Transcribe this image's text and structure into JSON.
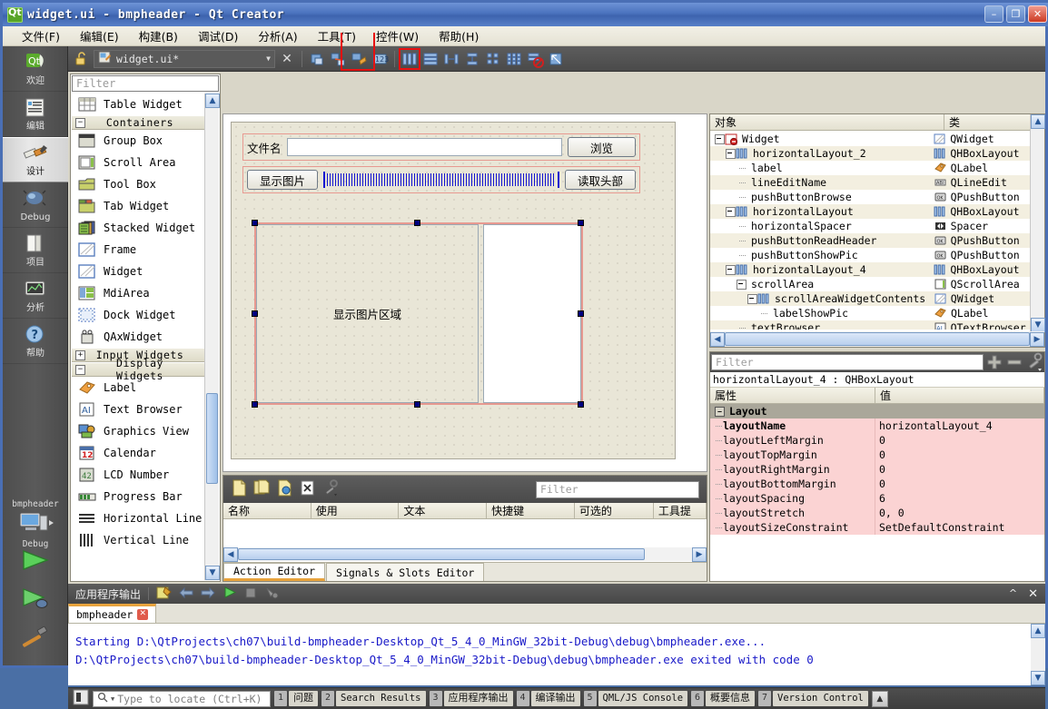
{
  "window": {
    "title": "widget.ui - bmpheader - Qt Creator",
    "logo_icon": "qt-logo-icon",
    "minimize_label": "–",
    "maximize_label": "❐",
    "close_label": "✕"
  },
  "menubar": {
    "items": [
      {
        "label": "文件(F)",
        "name": "menu-file"
      },
      {
        "label": "编辑(E)",
        "name": "menu-edit"
      },
      {
        "label": "构建(B)",
        "name": "menu-build"
      },
      {
        "label": "调试(D)",
        "name": "menu-debug"
      },
      {
        "label": "分析(A)",
        "name": "menu-analyze"
      },
      {
        "label": "工具(T)",
        "name": "menu-tools"
      },
      {
        "label": "控件(W)",
        "name": "menu-window"
      },
      {
        "label": "帮助(H)",
        "name": "menu-help"
      }
    ]
  },
  "modebar": {
    "items": [
      {
        "label": "欢迎",
        "icon": "qt-welcome-icon",
        "active": false
      },
      {
        "label": "编辑",
        "icon": "edit-document-icon",
        "active": false
      },
      {
        "label": "设计",
        "icon": "design-brush-icon",
        "active": true
      },
      {
        "label": "Debug",
        "icon": "debug-bug-icon",
        "active": false
      },
      {
        "label": "项目",
        "icon": "projects-folder-icon",
        "active": false
      },
      {
        "label": "分析",
        "icon": "analyze-chart-icon",
        "active": false
      },
      {
        "label": "帮助",
        "icon": "help-question-icon",
        "active": false
      }
    ],
    "kit": {
      "project": "bmpheader",
      "config": "Debug",
      "icon": "target-computer-icon"
    },
    "run_buttons": [
      {
        "name": "run-button",
        "icon": "run-play-icon"
      },
      {
        "name": "debug-button",
        "icon": "debug-play-icon"
      },
      {
        "name": "build-button",
        "icon": "build-hammer-icon"
      }
    ]
  },
  "editor_toolbar": {
    "lock_icon": "unlock-icon",
    "file_icon": "ui-file-icon",
    "filename": "widget.ui*",
    "dropdown_icon": "chevron-down-icon",
    "close_icon": "close-icon",
    "buttons": [
      {
        "name": "edit-widgets-button",
        "icon": "edit-widgets-icon",
        "highlighted": false
      },
      {
        "name": "edit-signals-slots-button",
        "icon": "edit-signals-slots-icon",
        "highlighted": false
      },
      {
        "name": "edit-buddies-button",
        "icon": "edit-buddies-icon",
        "highlighted": false
      },
      {
        "name": "edit-tab-order-button",
        "icon": "edit-tab-order-icon",
        "highlighted": false
      },
      {
        "name": "layout-horizontally-button",
        "icon": "layout-horizontal-icon",
        "highlighted": true
      },
      {
        "name": "layout-vertically-button",
        "icon": "layout-vertical-icon",
        "highlighted": false
      },
      {
        "name": "layout-splitter-horizontal-button",
        "icon": "splitter-horizontal-icon",
        "highlighted": false
      },
      {
        "name": "layout-splitter-vertical-button",
        "icon": "splitter-vertical-icon",
        "highlighted": false
      },
      {
        "name": "layout-form-button",
        "icon": "layout-form-icon",
        "highlighted": false
      },
      {
        "name": "layout-grid-button",
        "icon": "layout-grid-icon",
        "highlighted": false
      },
      {
        "name": "break-layout-button",
        "icon": "break-layout-icon",
        "highlighted": false
      },
      {
        "name": "adjust-size-button",
        "icon": "adjust-size-icon",
        "highlighted": false
      }
    ]
  },
  "widgetbox": {
    "filter_placeholder": "Filter",
    "scroll_up_icon": "chevron-up-icon",
    "scroll_down_icon": "chevron-down-icon",
    "entries": [
      {
        "type": "item",
        "label": "Table Widget",
        "icon": "table-widget-icon"
      },
      {
        "type": "category",
        "label": "Containers",
        "expanded": true
      },
      {
        "type": "item",
        "label": "Group Box",
        "icon": "group-box-icon"
      },
      {
        "type": "item",
        "label": "Scroll Area",
        "icon": "scroll-area-icon"
      },
      {
        "type": "item",
        "label": "Tool Box",
        "icon": "tool-box-icon"
      },
      {
        "type": "item",
        "label": "Tab Widget",
        "icon": "tab-widget-icon"
      },
      {
        "type": "item",
        "label": "Stacked Widget",
        "icon": "stacked-widget-icon"
      },
      {
        "type": "item",
        "label": "Frame",
        "icon": "frame-icon"
      },
      {
        "type": "item",
        "label": "Widget",
        "icon": "widget-icon"
      },
      {
        "type": "item",
        "label": "MdiArea",
        "icon": "mdi-area-icon"
      },
      {
        "type": "item",
        "label": "Dock Widget",
        "icon": "dock-widget-icon"
      },
      {
        "type": "item",
        "label": "QAxWidget",
        "icon": "qax-widget-icon"
      },
      {
        "type": "category",
        "label": "Input Widgets",
        "expanded": false
      },
      {
        "type": "category",
        "label": "Display Widgets",
        "expanded": true
      },
      {
        "type": "item",
        "label": "Label",
        "icon": "label-icon"
      },
      {
        "type": "item",
        "label": "Text Browser",
        "icon": "text-browser-icon"
      },
      {
        "type": "item",
        "label": "Graphics View",
        "icon": "graphics-view-icon"
      },
      {
        "type": "item",
        "label": "Calendar",
        "icon": "calendar-icon"
      },
      {
        "type": "item",
        "label": "LCD Number",
        "icon": "lcd-number-icon"
      },
      {
        "type": "item",
        "label": "Progress Bar",
        "icon": "progress-bar-icon"
      },
      {
        "type": "item",
        "label": "Horizontal Line",
        "icon": "horizontal-line-icon"
      },
      {
        "type": "item",
        "label": "Vertical Line",
        "icon": "vertical-line-icon"
      }
    ]
  },
  "form": {
    "row1": {
      "label": "文件名",
      "lineedit_value": "",
      "browse_button": "浏览"
    },
    "row2": {
      "showpic_button": "显示图片",
      "spacer_name": "horizontalSpacer",
      "readheader_button": "读取头部"
    },
    "pic_area_label": "显示图片区域"
  },
  "action_editor": {
    "toolbar_icons": [
      {
        "name": "new-action-icon"
      },
      {
        "name": "copy-action-icon"
      },
      {
        "name": "edit-action-icon"
      },
      {
        "name": "delete-action-icon"
      },
      {
        "name": "configure-icon"
      }
    ],
    "filter_placeholder": "Filter",
    "columns": [
      "名称",
      "使用",
      "文本",
      "快捷键",
      "可选的",
      "工具提"
    ],
    "rows": [],
    "tabs": [
      {
        "label": "Action Editor",
        "active": true
      },
      {
        "label": "Signals & Slots Editor",
        "active": false
      }
    ],
    "scroll_left_icon": "chevron-left-icon",
    "scroll_right_icon": "chevron-right-icon"
  },
  "object_inspector": {
    "columns": [
      "对象",
      "类"
    ],
    "rows": [
      {
        "indent": 0,
        "name": "Widget",
        "class": "QWidget",
        "icon": "qwidget-icon",
        "tw": "exp",
        "selected": false
      },
      {
        "indent": 1,
        "name": "horizontalLayout_2",
        "class": "QHBoxLayout",
        "icon": "hboxlayout-icon",
        "tw": "exp",
        "selected": true
      },
      {
        "indent": 2,
        "name": "label",
        "class": "QLabel",
        "icon": "qlabel-icon",
        "tw": "leaf",
        "selected": false
      },
      {
        "indent": 2,
        "name": "lineEditName",
        "class": "QLineEdit",
        "icon": "qlineedit-icon",
        "tw": "leaf",
        "selected": true
      },
      {
        "indent": 2,
        "name": "pushButtonBrowse",
        "class": "QPushButton",
        "icon": "qpushbutton-icon",
        "tw": "leaf",
        "selected": false
      },
      {
        "indent": 1,
        "name": "horizontalLayout",
        "class": "QHBoxLayout",
        "icon": "hboxlayout-icon",
        "tw": "exp",
        "selected": true
      },
      {
        "indent": 2,
        "name": "horizontalSpacer",
        "class": "Spacer",
        "icon": "spacer-icon",
        "tw": "leaf",
        "selected": false
      },
      {
        "indent": 2,
        "name": "pushButtonReadHeader",
        "class": "QPushButton",
        "icon": "qpushbutton-icon",
        "tw": "leaf",
        "selected": true
      },
      {
        "indent": 2,
        "name": "pushButtonShowPic",
        "class": "QPushButton",
        "icon": "qpushbutton-icon",
        "tw": "leaf",
        "selected": false
      },
      {
        "indent": 1,
        "name": "horizontalLayout_4",
        "class": "QHBoxLayout",
        "icon": "hboxlayout-icon",
        "tw": "exp",
        "selected": true
      },
      {
        "indent": 2,
        "name": "scrollArea",
        "class": "QScrollArea",
        "icon": "qscrollarea-icon",
        "tw": "exp",
        "selected": false
      },
      {
        "indent": 3,
        "name": "scrollAreaWidgetContents",
        "class": "QWidget",
        "icon": "qwidget-icon",
        "tw": "exp",
        "selected": true
      },
      {
        "indent": 4,
        "name": "labelShowPic",
        "class": "QLabel",
        "icon": "qlabel-icon",
        "tw": "leaf",
        "selected": false
      },
      {
        "indent": 2,
        "name": "textBrowser",
        "class": "QTextBrowser",
        "icon": "qtextbrowser-icon",
        "tw": "leaf",
        "selected": true
      }
    ],
    "scroll_up_icon": "chevron-up-icon",
    "scroll_down_icon": "chevron-down-icon",
    "hscroll_left_icon": "chevron-left-icon",
    "hscroll_right_icon": "chevron-right-icon"
  },
  "property_editor": {
    "filter_placeholder": "Filter",
    "toolbar_buttons": [
      {
        "name": "add-property-button",
        "icon": "plus-icon"
      },
      {
        "name": "remove-property-button",
        "icon": "minus-icon"
      },
      {
        "name": "configure-property-button",
        "icon": "wrench-icon"
      }
    ],
    "object_line": "horizontalLayout_4 : QHBoxLayout",
    "columns": [
      "属性",
      "值"
    ],
    "group": "Layout",
    "rows": [
      {
        "name": "layoutName",
        "value": "horizontalLayout_4",
        "bold": true
      },
      {
        "name": "layoutLeftMargin",
        "value": "0",
        "bold": false
      },
      {
        "name": "layoutTopMargin",
        "value": "0",
        "bold": false
      },
      {
        "name": "layoutRightMargin",
        "value": "0",
        "bold": false
      },
      {
        "name": "layoutBottomMargin",
        "value": "0",
        "bold": false
      },
      {
        "name": "layoutSpacing",
        "value": "6",
        "bold": false
      },
      {
        "name": "layoutStretch",
        "value": "0, 0",
        "bold": false
      },
      {
        "name": "layoutSizeConstraint",
        "value": "SetDefaultConstraint",
        "bold": false
      }
    ]
  },
  "output_pane": {
    "title": "应用程序输出",
    "toolbar_icons": [
      {
        "name": "output-settings-icon"
      },
      {
        "name": "prev-item-icon"
      },
      {
        "name": "next-item-icon"
      },
      {
        "name": "run-output-icon"
      },
      {
        "name": "stop-output-icon"
      },
      {
        "name": "attach-output-icon"
      }
    ],
    "minimize_icon": "chevron-up-icon",
    "close_icon": "close-icon",
    "tabs": [
      {
        "label": "bmpheader",
        "active": true,
        "close_icon": "close-tab-icon"
      }
    ],
    "lines": [
      "Starting D:\\QtProjects\\ch07\\build-bmpheader-Desktop_Qt_5_4_0_MinGW_32bit-Debug\\debug\\bmpheader.exe...",
      "D:\\QtProjects\\ch07\\build-bmpheader-Desktop_Qt_5_4_0_MinGW_32bit-Debug\\debug\\bmpheader.exe exited with code 0"
    ]
  },
  "statusbar": {
    "sidebar_toggle_icon": "sidebar-toggle-icon",
    "locator_icon": "search-icon",
    "locator_placeholder": "Type to locate (Ctrl+K)",
    "items": [
      {
        "num": "1",
        "label": "问题"
      },
      {
        "num": "2",
        "label": "Search Results"
      },
      {
        "num": "3",
        "label": "应用程序输出"
      },
      {
        "num": "4",
        "label": "编译输出"
      },
      {
        "num": "5",
        "label": "QML/JS Console"
      },
      {
        "num": "6",
        "label": "概要信息"
      },
      {
        "num": "7",
        "label": "Version Control"
      }
    ],
    "updown_icon": "updown-arrow-icon"
  },
  "colors": {
    "accent_orange": "#e8a33d",
    "title_blue": "#4a72bd",
    "highlight_red": "#e81010",
    "property_row_pink": "#fbd3d3",
    "form_canvas": "#e9e6d7",
    "output_text_blue": "#1919c8"
  }
}
